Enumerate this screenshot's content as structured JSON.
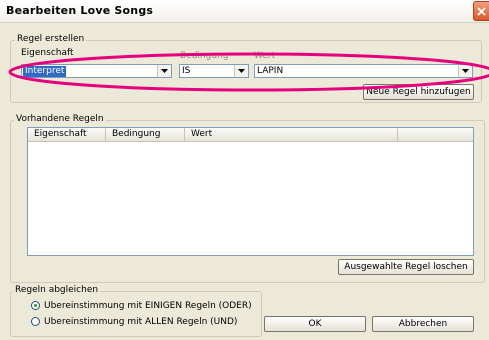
{
  "window": {
    "title": "Bearbeiten Love Songs"
  },
  "create_rule": {
    "legend": "Regel erstellen",
    "property_label": "Eigenschaft",
    "condition_label": "Bedingung",
    "value_label": "Wert",
    "property_value": "Interpret",
    "condition_value": "IS",
    "value_value": "LAPIN",
    "add_button": "Neue Regel hinzufugen"
  },
  "existing_rules": {
    "legend": "Vorhandene Regeln",
    "columns": [
      "Eigenschaft",
      "Bedingung",
      "Wert"
    ],
    "rows": [],
    "delete_button": "Ausgewahlte Regel loschen"
  },
  "match": {
    "legend": "Regeln abgleichen",
    "options": [
      {
        "label": "Ubereinstimmung mit EINIGEN Regeln (ODER)",
        "selected": true
      },
      {
        "label": "Ubereinstimmung mit ALLEN Regeln (UND)",
        "selected": false
      }
    ]
  },
  "footer": {
    "ok": "OK",
    "cancel": "Abbrechen"
  },
  "colors": {
    "annotation_ellipse": "#e6007e",
    "selection": "#316ac5",
    "close_button": "#d9582c"
  }
}
